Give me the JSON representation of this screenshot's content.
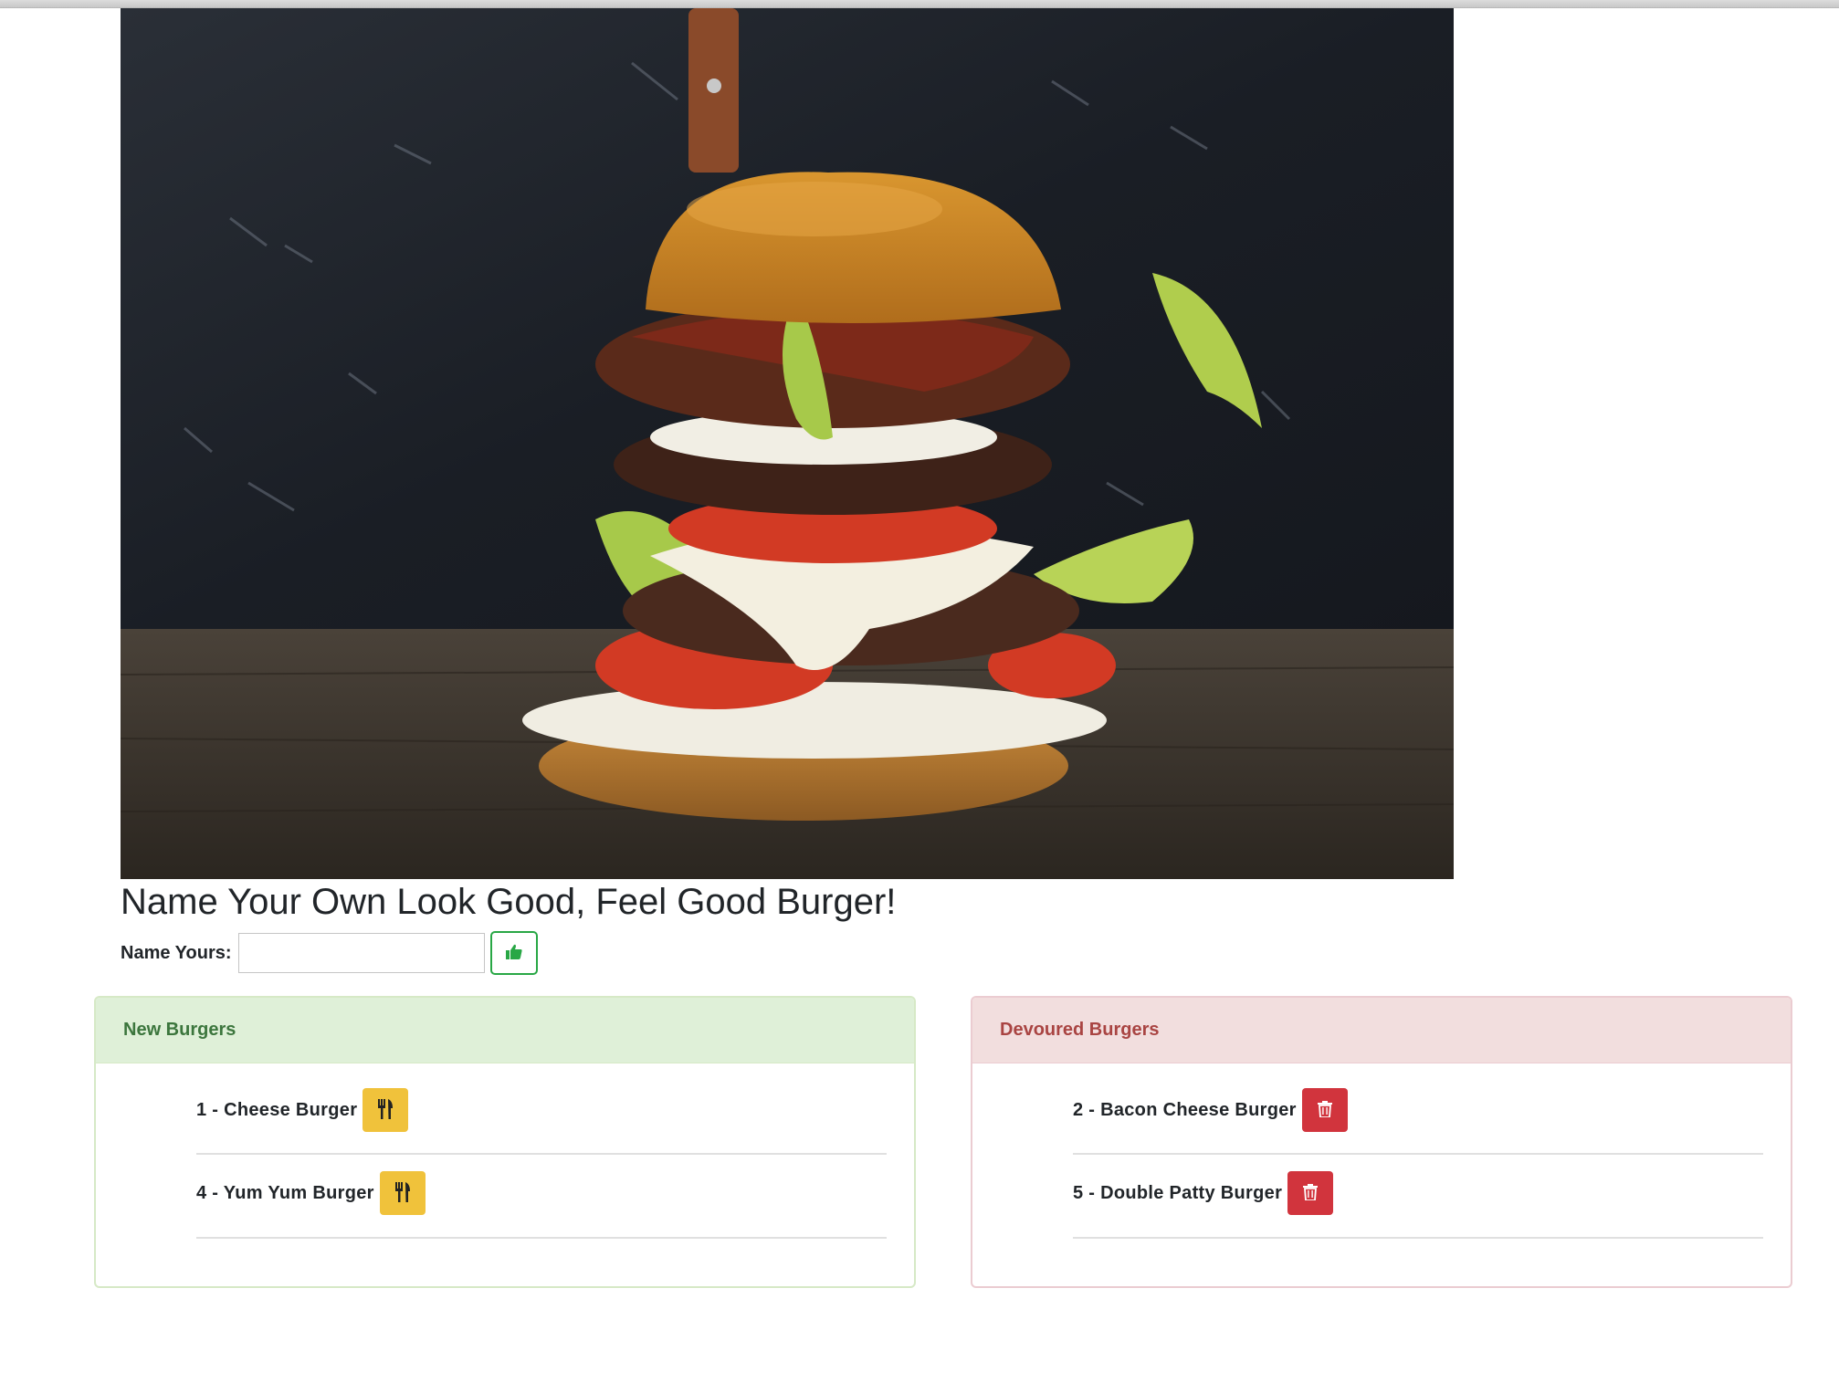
{
  "page": {
    "title": "Name Your Own Look Good, Feel Good Burger!"
  },
  "form": {
    "label": "Name Yours:",
    "input_value": "",
    "input_placeholder": "",
    "submit_icon": "thumbs-up-icon"
  },
  "new_burgers": {
    "header": "New Burgers",
    "items": [
      {
        "label": "1 - Cheese Burger",
        "action_icon": "fork-knife-icon"
      },
      {
        "label": "4 - Yum Yum Burger",
        "action_icon": "fork-knife-icon"
      }
    ]
  },
  "devoured_burgers": {
    "header": "Devoured Burgers",
    "items": [
      {
        "label": "2 - Bacon Cheese Burger",
        "action_icon": "trash-icon"
      },
      {
        "label": "5 - Double Patty Burger",
        "action_icon": "trash-icon"
      }
    ]
  },
  "colors": {
    "success": "#28a745",
    "warning": "#f0c23b",
    "danger": "#d1343d",
    "new_header_bg": "#dff0d8",
    "new_header_text": "#3c763d",
    "devoured_header_bg": "#f2dede",
    "devoured_header_text": "#a94442"
  }
}
